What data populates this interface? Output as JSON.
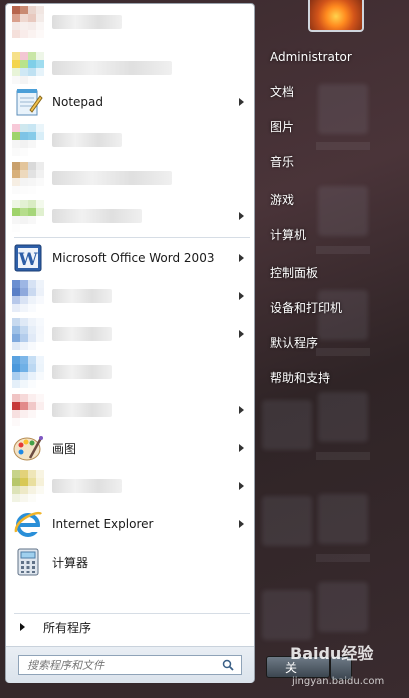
{
  "user": {
    "name": "Administrator"
  },
  "programs": [
    {
      "label": "",
      "blurred": true,
      "arrow": false
    },
    {
      "label": "",
      "blurred": true,
      "arrow": false
    },
    {
      "label": "Notepad",
      "icon": "notepad-icon",
      "arrow": true
    },
    {
      "label": "",
      "blurred": true,
      "arrow": false
    },
    {
      "label": "",
      "blurred": true,
      "arrow": false
    },
    {
      "label": "",
      "blurred": true,
      "arrow": true
    },
    {
      "label": "Microsoft Office Word 2003",
      "icon": "word-icon",
      "arrow": true
    },
    {
      "label": "",
      "blurred": true,
      "arrow": true
    },
    {
      "label": "",
      "blurred": true,
      "arrow": true
    },
    {
      "label": "",
      "blurred": true,
      "arrow": false
    },
    {
      "label": "",
      "blurred": true,
      "arrow": true
    },
    {
      "label": "画图",
      "icon": "paint-icon",
      "arrow": true
    },
    {
      "label": "",
      "blurred": true,
      "arrow": true
    },
    {
      "label": "Internet Explorer",
      "icon": "ie-icon",
      "arrow": true
    },
    {
      "label": "计算器",
      "icon": "calculator-icon",
      "arrow": false
    }
  ],
  "all_programs": "所有程序",
  "search": {
    "placeholder": "搜索程序和文件"
  },
  "right_pane": {
    "items": [
      "文档",
      "图片",
      "音乐",
      "游戏",
      "计算机",
      "控制面板",
      "设备和打印机",
      "默认程序",
      "帮助和支持"
    ]
  },
  "shutdown": {
    "label": "关"
  },
  "watermark": {
    "line1": "Baidu经验",
    "line2": "jingyan.baidu.com"
  }
}
